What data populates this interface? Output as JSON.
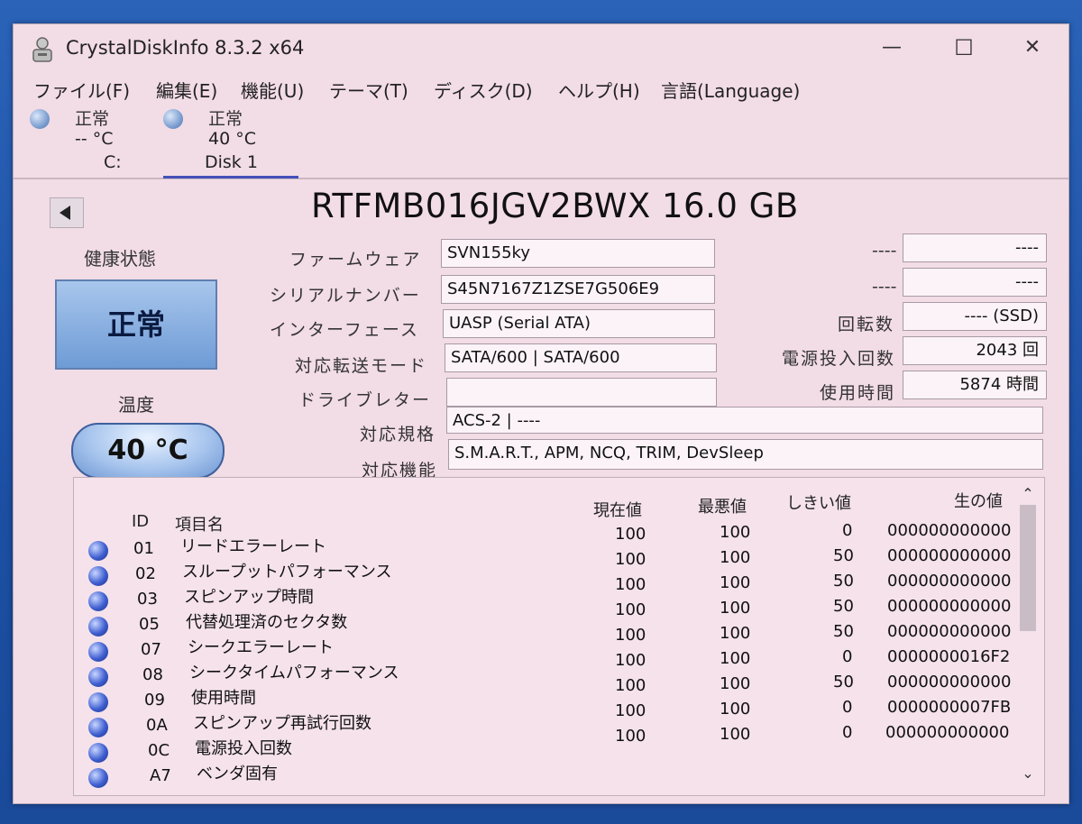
{
  "title": "CrystalDiskInfo 8.3.2 x64",
  "menu": [
    "ファイル(F)",
    "編集(E)",
    "機能(U)",
    "テーマ(T)",
    "ディスク(D)",
    "ヘルプ(H)",
    "言語(Language)"
  ],
  "disks": [
    {
      "status": "正常",
      "temp": "-- °C",
      "name": "C:"
    },
    {
      "status": "正常",
      "temp": "40 °C",
      "name": "Disk 1"
    }
  ],
  "model": "RTFMB016JGV2BWX 16.0 GB",
  "health": {
    "label": "健康状態",
    "value": "正常"
  },
  "temperature": {
    "label": "温度",
    "value": "40 °C"
  },
  "info": {
    "firmware_label": "ファームウェア",
    "firmware": "SVN155ky",
    "serial_label": "シリアルナンバー",
    "serial": "S45N7167Z1ZSE7G506E9",
    "interface_label": "インターフェース",
    "interface": "UASP (Serial ATA)",
    "transfer_label": "対応転送モード",
    "transfer": "SATA/600 | SATA/600",
    "drive_letter_label": "ドライブレター",
    "drive_letter": "",
    "standard_label": "対応規格",
    "standard": "ACS-2 | ----",
    "features_label": "対応機能",
    "features": "S.M.A.R.T., APM, NCQ, TRIM, DevSleep"
  },
  "right_info": {
    "r1_label": "----",
    "r1_value": "----",
    "r2_label": "----",
    "r2_value": "----",
    "rotation_label": "回転数",
    "rotation": "---- (SSD)",
    "power_count_label": "電源投入回数",
    "power_count": "2043 回",
    "hours_label": "使用時間",
    "hours": "5874 時間"
  },
  "smart_headers": {
    "id": "ID",
    "name": "項目名",
    "current": "現在値",
    "worst": "最悪値",
    "threshold": "しきい値",
    "raw": "生の値"
  },
  "smart_rows": [
    {
      "id": "01",
      "name": "リードエラーレート",
      "current": "100",
      "worst": "100",
      "threshold": "0",
      "raw": "000000000000"
    },
    {
      "id": "02",
      "name": "スループットパフォーマンス",
      "current": "100",
      "worst": "100",
      "threshold": "50",
      "raw": "000000000000"
    },
    {
      "id": "03",
      "name": "スピンアップ時間",
      "current": "100",
      "worst": "100",
      "threshold": "50",
      "raw": "000000000000"
    },
    {
      "id": "05",
      "name": "代替処理済のセクタ数",
      "current": "100",
      "worst": "100",
      "threshold": "50",
      "raw": "000000000000"
    },
    {
      "id": "07",
      "name": "シークエラーレート",
      "current": "100",
      "worst": "100",
      "threshold": "50",
      "raw": "000000000000"
    },
    {
      "id": "08",
      "name": "シークタイムパフォーマンス",
      "current": "100",
      "worst": "100",
      "threshold": "0",
      "raw": "0000000016F2"
    },
    {
      "id": "09",
      "name": "使用時間",
      "current": "100",
      "worst": "100",
      "threshold": "50",
      "raw": "000000000000"
    },
    {
      "id": "0A",
      "name": "スピンアップ再試行回数",
      "current": "100",
      "worst": "100",
      "threshold": "0",
      "raw": "0000000007FB"
    },
    {
      "id": "0C",
      "name": "電源投入回数",
      "current": "100",
      "worst": "100",
      "threshold": "0",
      "raw": "000000000000"
    },
    {
      "id": "A7",
      "name": "ベンダ固有",
      "current": "",
      "worst": "",
      "threshold": "",
      "raw": ""
    }
  ],
  "colors": {
    "window_bg": "#f2dce6",
    "health_good": "#6e9bd6",
    "smart_ok": "#3f5fd1",
    "desktop": "#2a63b8"
  }
}
